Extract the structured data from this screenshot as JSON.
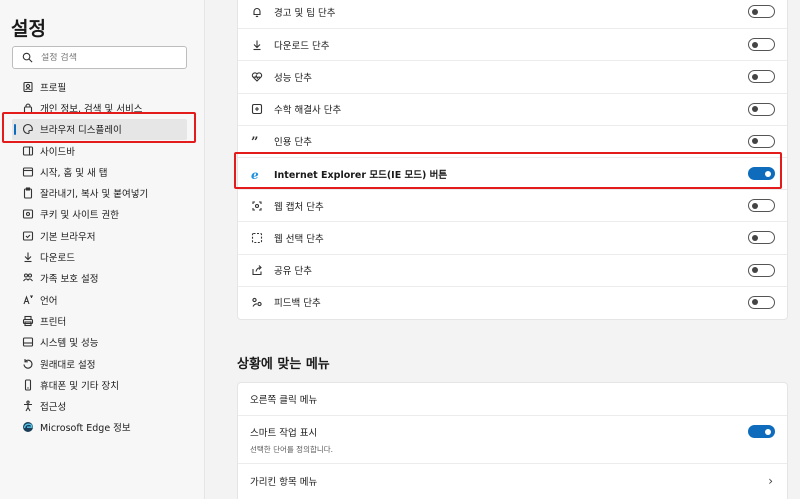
{
  "sidebar": {
    "title": "설정",
    "search_placeholder": "설정 검색",
    "items": [
      {
        "label": "프로필",
        "icon": "profile-icon"
      },
      {
        "label": "개인 정보, 검색 및 서비스",
        "icon": "lock-icon"
      },
      {
        "label": "브라우저 디스플레이",
        "icon": "palette-icon",
        "active": true
      },
      {
        "label": "사이드바",
        "icon": "sidebar-icon"
      },
      {
        "label": "시작, 홈 및 새 탭",
        "icon": "home-tab-icon"
      },
      {
        "label": "잘라내기, 복사 및 붙여넣기",
        "icon": "clipboard-icon"
      },
      {
        "label": "쿠키 및 사이트 권한",
        "icon": "cookie-icon"
      },
      {
        "label": "기본 브라우저",
        "icon": "browser-icon"
      },
      {
        "label": "다운로드",
        "icon": "download-icon"
      },
      {
        "label": "가족 보호 설정",
        "icon": "family-icon"
      },
      {
        "label": "언어",
        "icon": "language-icon"
      },
      {
        "label": "프린터",
        "icon": "printer-icon"
      },
      {
        "label": "시스템 및 성능",
        "icon": "system-icon"
      },
      {
        "label": "원래대로 설정",
        "icon": "reset-icon"
      },
      {
        "label": "휴대폰 및 기타 장치",
        "icon": "phone-icon"
      },
      {
        "label": "접근성",
        "icon": "accessibility-icon"
      },
      {
        "label": "Microsoft Edge 정보",
        "icon": "edge-icon"
      }
    ]
  },
  "toolbar_buttons": [
    {
      "label": "경고 및 팁 단추",
      "icon": "bell-icon",
      "on": false
    },
    {
      "label": "다운로드 단추",
      "icon": "download-icon",
      "on": false
    },
    {
      "label": "성능 단추",
      "icon": "heart-pulse-icon",
      "on": false
    },
    {
      "label": "수학 해결사 단추",
      "icon": "math-icon",
      "on": false
    },
    {
      "label": "인용 단추",
      "icon": "quote-icon",
      "on": false
    },
    {
      "label": "Internet Explorer 모드(IE 모드) 버튼",
      "icon": "ie-icon",
      "on": true
    },
    {
      "label": "웹 캡처 단추",
      "icon": "web-capture-icon",
      "on": false
    },
    {
      "label": "웹 선택 단추",
      "icon": "web-select-icon",
      "on": false
    },
    {
      "label": "공유 단추",
      "icon": "share-icon",
      "on": false
    },
    {
      "label": "피드백 단추",
      "icon": "feedback-icon",
      "on": false
    }
  ],
  "context_menu": {
    "title": "상황에 맞는 메뉴",
    "right_click_label": "오른쪽 클릭 메뉴",
    "smart_actions_label": "스마트 작업 표시",
    "smart_actions_sub": "선택한 단어를 정의합니다.",
    "smart_actions_on": true,
    "hidden_menu_label": "가리킨 항목 메뉴"
  },
  "colors": {
    "accent": "#0f6cbd",
    "highlight": "#e31b1b"
  }
}
